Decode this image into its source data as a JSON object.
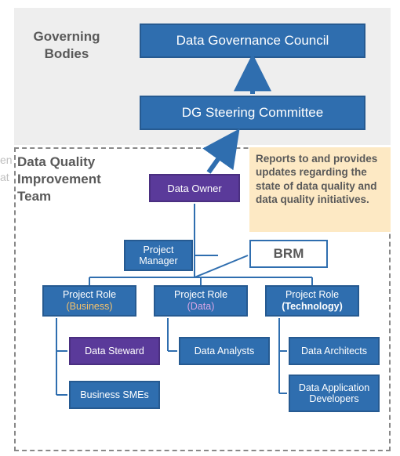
{
  "governing": {
    "label": "Governing Bodies",
    "council": "Data Governance Council",
    "steering": "DG Steering Committee"
  },
  "dq_team_label": "Data Quality Improvement Team",
  "callout": "Reports to and provides updates regarding the state of data quality and data quality initiatives.",
  "data_owner": "Data Owner",
  "pm": "Project Manager",
  "brm": "BRM",
  "roles": {
    "business": {
      "title": "Project Role",
      "sub": "(Business)"
    },
    "data": {
      "title": "Project Role",
      "sub": "(Data)"
    },
    "tech": {
      "title": "Project Role",
      "sub": "(Technology)"
    }
  },
  "leaves": {
    "steward": "Data Steward",
    "smes": "Business SMEs",
    "analysts": "Data Analysts",
    "architects": "Data Architects",
    "devs": "Data Application Developers"
  },
  "edge": {
    "en": "en",
    "at": "at"
  },
  "colors": {
    "blue": "#2f6eaf",
    "purple": "#5a3a9a",
    "callout_bg": "#fde9c4",
    "panel_bg": "#eeeeee",
    "text_gray": "#595959"
  }
}
